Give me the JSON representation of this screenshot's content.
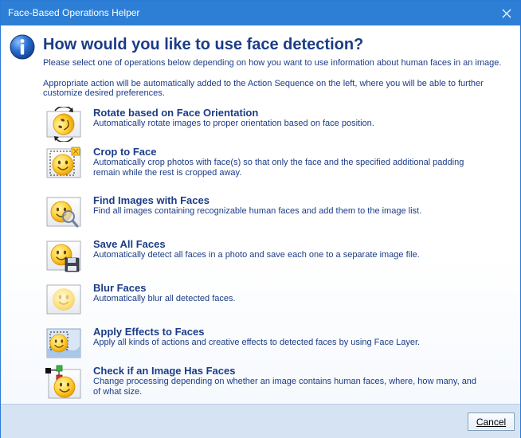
{
  "window": {
    "title": "Face-Based Operations Helper"
  },
  "header": {
    "heading": "How would you like to use face detection?",
    "description1": "Please select one of operations below depending on how you want to use information about human faces in an image.",
    "description2": "Appropriate action will be automatically added to the Action Sequence on the left, where you will be able to further customize desired preferences."
  },
  "operations": [
    {
      "title": "Rotate based on Face Orientation",
      "description": "Automatically rotate images to proper orientation based on face position.",
      "icon": "rotate-face-icon"
    },
    {
      "title": "Crop to Face",
      "description": "Automatically crop photos with face(s) so that only the face and the specified additional padding remain while the rest is cropped away.",
      "icon": "crop-face-icon"
    },
    {
      "title": "Find Images with Faces",
      "description": "Find all images containing recognizable human faces and add them to the image list.",
      "icon": "find-face-icon"
    },
    {
      "title": "Save All Faces",
      "description": "Automatically detect all faces in a photo and save each one to a separate image file.",
      "icon": "save-face-icon"
    },
    {
      "title": "Blur Faces",
      "description": "Automatically blur all detected faces.",
      "icon": "blur-face-icon"
    },
    {
      "title": "Apply Effects to Faces",
      "description": "Apply all kinds of actions and creative effects to detected faces by using Face Layer.",
      "icon": "effects-face-icon"
    },
    {
      "title": "Check if an Image Has Faces",
      "description": "Change processing depending on whether an image contains human faces, where, how many, and of what size.",
      "icon": "check-face-icon"
    }
  ],
  "footer": {
    "cancel_label": "Cancel"
  },
  "colors": {
    "titlebar": "#2d7fd6",
    "heading_text": "#1b3c86",
    "footer": "#d6e3f3"
  }
}
